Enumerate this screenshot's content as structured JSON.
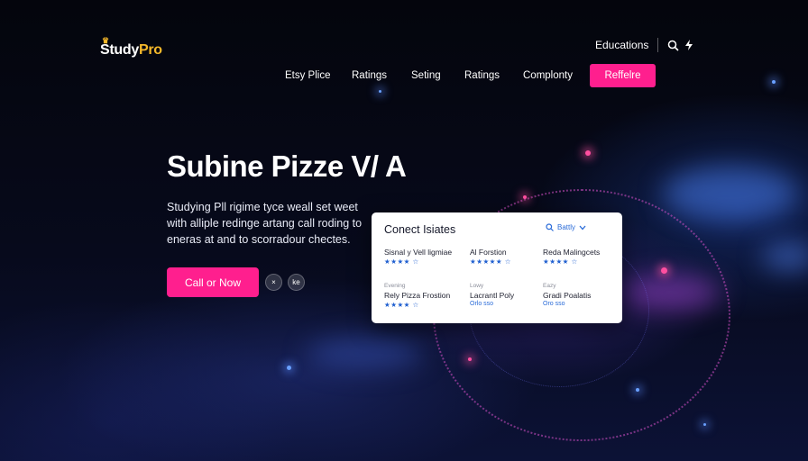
{
  "brand": {
    "logo_part1": "Study",
    "logo_part2": "Pro",
    "crown_icon": "crown-icon"
  },
  "top_bar": {
    "link": "Educations",
    "search_icon": "search-icon",
    "bolt_icon": "bolt-icon"
  },
  "nav": {
    "items": [
      "Etsy Plice",
      "Ratings",
      "Seting",
      "Ratings",
      "Complonty"
    ],
    "cta": "Reffelre"
  },
  "hero": {
    "title": "Subine Pizze V/ A",
    "description": "Studying Pll rigime tyce weall set weet with alliple redinge artang call roding to eneras at and to scorradour chectes.",
    "cta": "Call or Now",
    "icon_button_1": "×",
    "icon_button_2": "ke"
  },
  "card": {
    "title": "Conect Isiates",
    "filter_label": "Battly",
    "filter_icon": "search-icon",
    "items": [
      {
        "category": "",
        "name": "Sisnal y Vell ligmiae",
        "stars": "★★★★ ☆",
        "meta": ""
      },
      {
        "category": "",
        "name": "Al Forstion",
        "stars": "★★★★★ ☆",
        "meta": ""
      },
      {
        "category": "",
        "name": "Reda Malingcets",
        "stars": "★★★★ ☆",
        "meta": ""
      },
      {
        "category": "Evening",
        "name": "Rely Pizza Frostion",
        "stars": "★★★★ ☆",
        "meta": ""
      },
      {
        "category": "Lowy",
        "name": "Lacrantl Poly",
        "stars": "",
        "meta": "Orlo sso"
      },
      {
        "category": "Eazy",
        "name": "Gradi Poalatis",
        "stars": "",
        "meta": "Oro sso"
      }
    ]
  },
  "colors": {
    "accent": "#ff1f8e",
    "brand_gold": "#f5b82a",
    "star_blue": "#1f5fd0",
    "background": "#05060f"
  }
}
